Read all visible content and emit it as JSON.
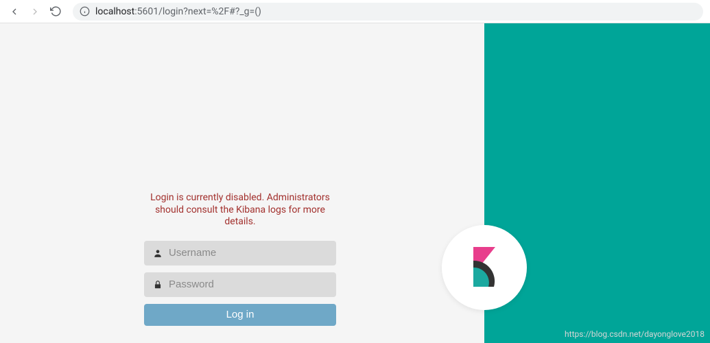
{
  "browser": {
    "url_host_prefix": "localhost",
    "url_rest": ":5601/login?next=%2F#?_g=()"
  },
  "login": {
    "error": "Login is currently disabled. Administrators should consult the Kibana logs for more details.",
    "username_placeholder": "Username",
    "password_placeholder": "Password",
    "button_label": "Log in"
  },
  "watermark": "https://blog.csdn.net/dayonglove2018",
  "colors": {
    "accent": "#00a598",
    "button": "#6fa8c7",
    "error": "#a2302d",
    "logo_pink": "#e83e8c",
    "logo_dark": "#333333",
    "logo_teal": "#1ba9a0"
  }
}
